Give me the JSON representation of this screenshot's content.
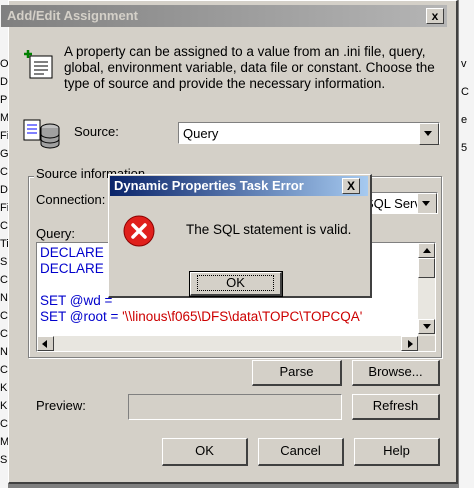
{
  "background": {
    "left_fragments": [
      "O",
      "D",
      "P",
      "M",
      "Fi",
      "G",
      "C",
      "D",
      "Fi",
      "C",
      "Ti",
      "S",
      "C",
      "N",
      "C",
      "C",
      "N",
      "C",
      "Ki",
      "Ki",
      "C",
      "M",
      "S"
    ],
    "right_fragments": [
      "v",
      "C",
      "e",
      "5"
    ]
  },
  "dialog": {
    "title": "Add/Edit Assignment",
    "close_glyph": "x",
    "description": "A property can be assigned to a value from an .ini file, query, global, environment variable, data file or constant.  Choose the type of source and provide the necessary information.",
    "source_label": "Source:",
    "source_value": "Query",
    "group_label": "Source information",
    "connection_label": "Connection:",
    "connection_value": "SQL Serve",
    "query_label": "Query:",
    "query_lines": [
      {
        "blue": "DECLARE @",
        "red": ""
      },
      {
        "blue": "DECLARE @",
        "red": ""
      },
      {
        "blue": "",
        "red": ""
      },
      {
        "blue": "SET @wd = ",
        "red": ""
      },
      {
        "blue": "SET @root = ",
        "red": "'\\\\linous\\f065\\DFS\\data\\TOPC\\TOPCQA'"
      }
    ],
    "parse_label": "Parse",
    "browse_label": "Browse...",
    "preview_label": "Preview:",
    "preview_value": "",
    "refresh_label": "Refresh",
    "ok_label": "OK",
    "cancel_label": "Cancel",
    "help_label": "Help"
  },
  "error_dialog": {
    "title": "Dynamic Properties Task Error",
    "close_glyph": "X",
    "message": "The SQL statement is valid.",
    "ok_label": "OK"
  },
  "colors": {
    "dialog_face": "#d4d0c8",
    "active_title": "#0a246a",
    "inactive_title": "#808080",
    "error_icon": "#e0201c",
    "code_keyword": "#0000cc",
    "code_string": "#cc0000"
  }
}
